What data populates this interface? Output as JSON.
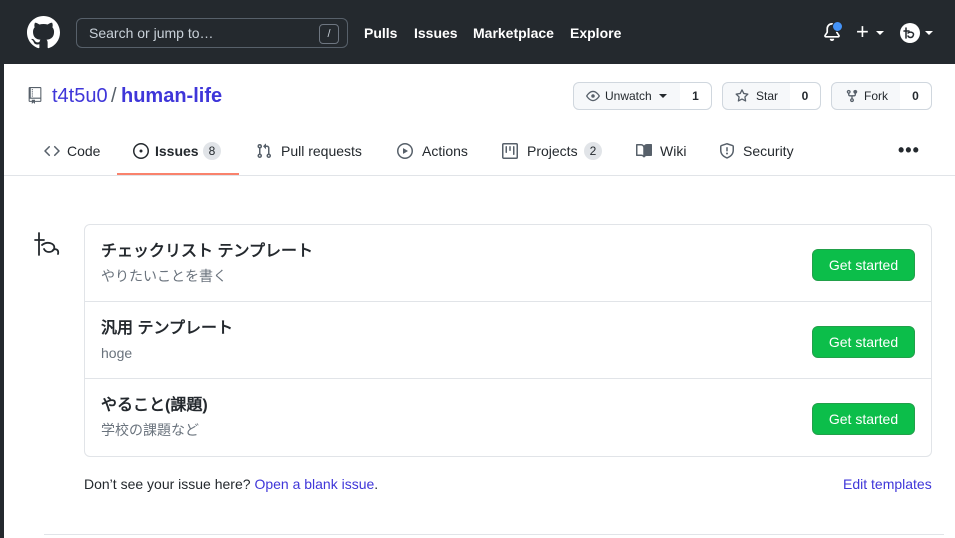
{
  "header": {
    "search_placeholder": "Search or jump to…",
    "search_key": "/",
    "nav": [
      "Pulls",
      "Issues",
      "Marketplace",
      "Explore"
    ],
    "plus": "+"
  },
  "repo": {
    "owner": "t4t5u0",
    "separator": "/",
    "name": "human-life",
    "watch": {
      "label": "Unwatch",
      "count": "1"
    },
    "star": {
      "label": "Star",
      "count": "0"
    },
    "fork": {
      "label": "Fork",
      "count": "0"
    }
  },
  "tabs": [
    {
      "label": "Code",
      "icon": "code-icon"
    },
    {
      "label": "Issues",
      "icon": "issue-opened-icon",
      "count": "8"
    },
    {
      "label": "Pull requests",
      "icon": "git-pull-request-icon"
    },
    {
      "label": "Actions",
      "icon": "play-icon"
    },
    {
      "label": "Projects",
      "icon": "project-icon",
      "count": "2"
    },
    {
      "label": "Wiki",
      "icon": "book-icon"
    },
    {
      "label": "Security",
      "icon": "shield-icon"
    }
  ],
  "more": "•••",
  "templates": [
    {
      "title": "チェックリスト テンプレート",
      "description": "やりたいことを書く",
      "button": "Get started"
    },
    {
      "title": "汎用 テンプレート",
      "description": "hoge",
      "button": "Get started"
    },
    {
      "title": "やること(課題)",
      "description": "学校の課題など",
      "button": "Get started"
    }
  ],
  "footer": {
    "prompt": "Don’t see your issue here?",
    "blank_link": "Open a blank issue",
    "period": ".",
    "edit_templates": "Edit templates"
  },
  "colors": {
    "header_bg": "#24292e",
    "link": "#3f36d9",
    "primary_button": "#0cbe4a",
    "active_tab": "#f9826c",
    "notification": "#4493f8"
  }
}
